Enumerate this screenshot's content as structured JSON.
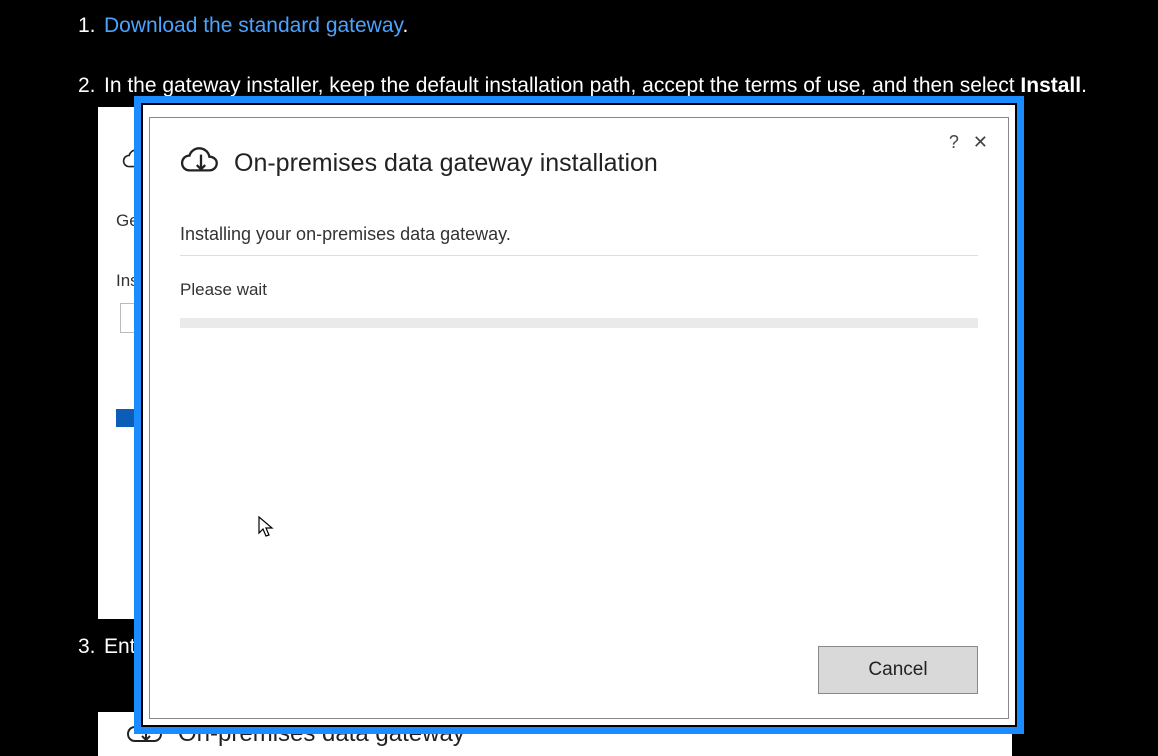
{
  "steps": {
    "s1": {
      "num": "1.",
      "link": "Download the standard gateway",
      "after": "."
    },
    "s2": {
      "num": "2.",
      "textA": "In the gateway installer, keep the default installation path, accept the terms of use, and then select ",
      "bold": "Install",
      "textB": "."
    },
    "s3": {
      "num": "3.",
      "textA": "Enter"
    }
  },
  "under": {
    "frag1": "Ge",
    "frag2": "Ins",
    "partialTitle": "On-premises data gateway"
  },
  "dialog": {
    "title": "On-premises data gateway installation",
    "subtitle": "Installing your on-premises data gateway.",
    "wait": "Please wait",
    "cancel": "Cancel",
    "help": "?",
    "close": "✕"
  }
}
